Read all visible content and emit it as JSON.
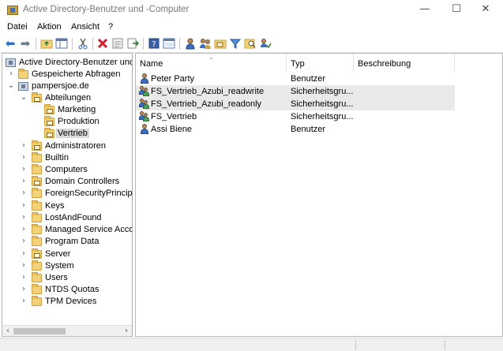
{
  "window": {
    "title": "Active Directory-Benutzer und -Computer",
    "controls": {
      "minimize": "—",
      "maximize": "☐",
      "close": "✕"
    }
  },
  "menu": [
    {
      "label": "Datei"
    },
    {
      "label": "Aktion"
    },
    {
      "label": "Ansicht"
    },
    {
      "label": "?"
    }
  ],
  "toolbar": {
    "icons": [
      "back-arrow-icon",
      "forward-arrow-icon",
      "up-folder-icon",
      "show-tree-icon",
      "cut-icon",
      "delete-icon",
      "properties-icon",
      "export-icon",
      "help-icon",
      "console-icon",
      "new-user-icon",
      "new-group-icon",
      "new-ou-icon",
      "filter-icon",
      "find-icon",
      "delegate-icon"
    ]
  },
  "tree": {
    "root": "Active Directory-Benutzer und -",
    "items": [
      {
        "label": "Gespeicherte Abfragen"
      },
      {
        "label": "pampersjoe.de"
      },
      {
        "label": "Abteilungen"
      },
      {
        "label": "Marketing"
      },
      {
        "label": "Produktion"
      },
      {
        "label": "Vertrieb"
      },
      {
        "label": "Administratoren"
      },
      {
        "label": "Builtin"
      },
      {
        "label": "Computers"
      },
      {
        "label": "Domain Controllers"
      },
      {
        "label": "ForeignSecurityPrincipals"
      },
      {
        "label": "Keys"
      },
      {
        "label": "LostAndFound"
      },
      {
        "label": "Managed Service Accounts"
      },
      {
        "label": "Program Data"
      },
      {
        "label": "Server"
      },
      {
        "label": "System"
      },
      {
        "label": "Users"
      },
      {
        "label": "NTDS Quotas"
      },
      {
        "label": "TPM Devices"
      }
    ],
    "selected": "Vertrieb",
    "scroll_left": "‹",
    "scroll_right": "›"
  },
  "list": {
    "columns": [
      {
        "label": "Name"
      },
      {
        "label": "Typ"
      },
      {
        "label": "Beschreibung"
      }
    ],
    "sort_indicator": "⌄",
    "rows": [
      {
        "name": "Peter Party",
        "type": "Benutzer",
        "description": "",
        "icon": "user-icon"
      },
      {
        "name": "FS_Vertrieb_Azubi_readwrite",
        "type": "Sicherheitsgru...",
        "description": "",
        "icon": "group-icon"
      },
      {
        "name": "FS_Vertrieb_Azubi_readonly",
        "type": "Sicherheitsgru...",
        "description": "",
        "icon": "group-icon"
      },
      {
        "name": "FS_Vertrieb",
        "type": "Sicherheitsgru...",
        "description": "",
        "icon": "group-icon"
      },
      {
        "name": "Assi Biene",
        "type": "Benutzer",
        "description": "",
        "icon": "user-icon"
      }
    ]
  },
  "colors": {
    "folder": "#f3d27a",
    "selection": "#d9d9d9",
    "row_highlight": "#e9e9e9",
    "accent_blue": "#2a6cc8"
  }
}
